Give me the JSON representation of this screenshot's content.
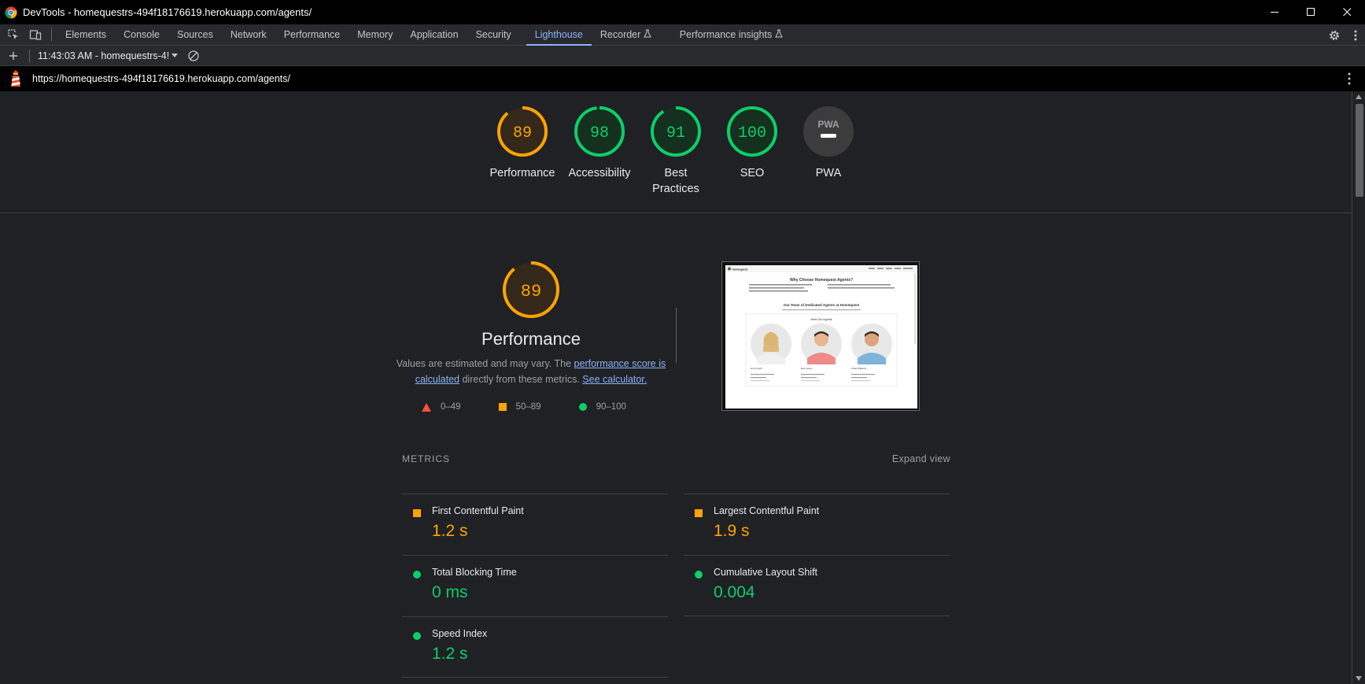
{
  "window": {
    "title": "DevTools - homequestrs-494f18176619.herokuapp.com/agents/"
  },
  "tabs": [
    {
      "label": "Elements"
    },
    {
      "label": "Console"
    },
    {
      "label": "Sources"
    },
    {
      "label": "Network"
    },
    {
      "label": "Performance"
    },
    {
      "label": "Memory"
    },
    {
      "label": "Application"
    },
    {
      "label": "Security"
    },
    {
      "label": "Lighthouse"
    },
    {
      "label": "Recorder"
    },
    {
      "label": "Performance insights"
    }
  ],
  "subbar": {
    "report_select": "11:43:03 AM - homequestrs-4!"
  },
  "url": "https://homequestrs-494f18176619.herokuapp.com/agents/",
  "gauges": [
    {
      "score": "89",
      "label": "Performance",
      "color": "#ffa400"
    },
    {
      "score": "98",
      "label": "Accessibility",
      "color": "#0cce6b"
    },
    {
      "score": "91",
      "label": "Best Practices",
      "color": "#0cce6b"
    },
    {
      "score": "100",
      "label": "SEO",
      "color": "#0cce6b"
    },
    {
      "score": "PWA",
      "label": "PWA",
      "color": "#5f6368"
    }
  ],
  "performance": {
    "score": "89",
    "title": "Performance",
    "desc_prefix": "Values are estimated and may vary. The ",
    "desc_link": "performance score is calculated",
    "desc_mid": " directly from these metrics. ",
    "desc_link2": "See calculator."
  },
  "legend": [
    {
      "range": "0–49",
      "color": "#ff4e42"
    },
    {
      "range": "50–89",
      "color": "#ffa400"
    },
    {
      "range": "90–100",
      "color": "#0cce6b"
    }
  ],
  "screenshot": {
    "brand": "Homequest",
    "heading1": "Why Choose Homequest Agents?",
    "heading2": "Our Team of Dedicated Agents at Homequest",
    "card_title": "Meet Our Agents",
    "agents": [
      "Amy Smith",
      "Rob Jones",
      "Chad Williams"
    ]
  },
  "metrics": {
    "header": "METRICS",
    "expand": "Expand view",
    "items": [
      {
        "name": "First Contentful Paint",
        "value": "1.2 s",
        "status": "orange"
      },
      {
        "name": "Largest Contentful Paint",
        "value": "1.9 s",
        "status": "orange"
      },
      {
        "name": "Total Blocking Time",
        "value": "0 ms",
        "status": "green"
      },
      {
        "name": "Cumulative Layout Shift",
        "value": "0.004",
        "status": "green"
      },
      {
        "name": "Speed Index",
        "value": "1.2 s",
        "status": "green"
      }
    ]
  }
}
